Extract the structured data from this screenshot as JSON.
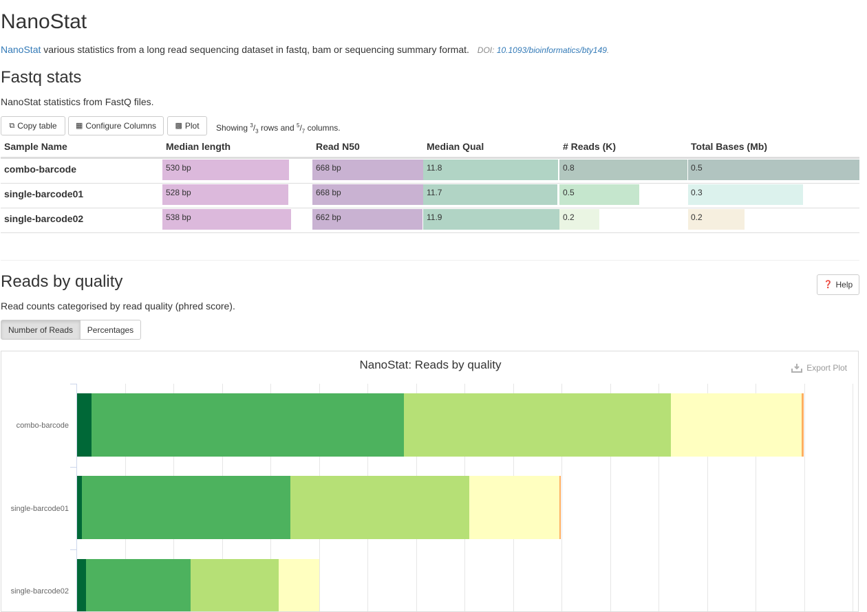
{
  "title": "NanoStat",
  "intro": {
    "link_text": "NanoStat",
    "text": " various statistics from a long read sequencing dataset in fastq, bam or sequencing summary format.",
    "doi_label": "DOI: ",
    "doi_link": "10.1093/bioinformatics/bty149",
    "doi_suffix": "."
  },
  "fastq": {
    "heading": "Fastq stats",
    "description": "NanoStat statistics from FastQ files.",
    "buttons": {
      "copy": "Copy table",
      "configure": "Configure Columns",
      "plot": "Plot"
    },
    "showing": {
      "prefix": "Showing ",
      "rows_shown": "3",
      "rows_total": "3",
      "mid": " rows and ",
      "cols_shown": "5",
      "cols_total": "7",
      "suffix": " columns."
    },
    "columns": [
      "Sample Name",
      "Median length",
      "Read N50",
      "Median Qual",
      "# Reads (K)",
      "Total Bases (Mb)"
    ],
    "column_colors": [
      "",
      "#dcb9dc",
      "#c9b2d2",
      "#b1d4c5",
      "#b2cec0",
      "#b1c8c0"
    ],
    "rows": [
      {
        "sample": "combo-barcode",
        "median_length": "530 bp",
        "read_n50": "668 bp",
        "median_qual": "11.8",
        "reads_k": "0.8",
        "total_bases": "0.5",
        "fill": {
          "median_length": 0.985,
          "read_n50": 1.0,
          "median_qual": 0.99,
          "reads_k": 1.0,
          "total_bases": 1.0
        },
        "colors": {
          "reads_k": "#b2c7bf",
          "total_bases": "#b1c4c0"
        }
      },
      {
        "sample": "single-barcode01",
        "median_length": "528 bp",
        "read_n50": "668 bp",
        "median_qual": "11.7",
        "reads_k": "0.5",
        "total_bases": "0.3",
        "fill": {
          "median_length": 0.981,
          "read_n50": 1.0,
          "median_qual": 0.983,
          "reads_k": 0.625,
          "total_bases": 0.67
        },
        "colors": {
          "reads_k": "#c5e6cd",
          "total_bases": "#dcf2ed"
        }
      },
      {
        "sample": "single-barcode02",
        "median_length": "538 bp",
        "read_n50": "662 bp",
        "median_qual": "11.9",
        "reads_k": "0.2",
        "total_bases": "0.2",
        "fill": {
          "median_length": 1.0,
          "read_n50": 0.991,
          "median_qual": 1.0,
          "reads_k": 0.31,
          "total_bases": 0.33
        },
        "colors": {
          "reads_k": "#eaf5e3",
          "total_bases": "#f6efdf"
        }
      }
    ]
  },
  "quality": {
    "heading": "Reads by quality",
    "help_label": "Help",
    "description": "Read counts categorised by read quality (phred score).",
    "tab_reads": "Number of Reads",
    "tab_percent": "Percentages",
    "export_label": "Export Plot"
  },
  "chart_data": {
    "type": "bar",
    "orientation": "horizontal",
    "stacked": true,
    "title": "NanoStat: Reads by quality",
    "categories": [
      "combo-barcode",
      "single-barcode01",
      "single-barcode02"
    ],
    "series": [
      {
        "color": "#006837",
        "values": [
          15,
          5,
          9
        ]
      },
      {
        "color": "#4db25e",
        "values": [
          322,
          215,
          108
        ]
      },
      {
        "color": "#b6e076",
        "values": [
          275,
          184,
          91
        ]
      },
      {
        "color": "#ffffc0",
        "values": [
          135,
          93,
          42
        ]
      },
      {
        "color": "#fdae61",
        "values": [
          2,
          1,
          0
        ]
      }
    ],
    "grid": true,
    "legend": "none"
  }
}
